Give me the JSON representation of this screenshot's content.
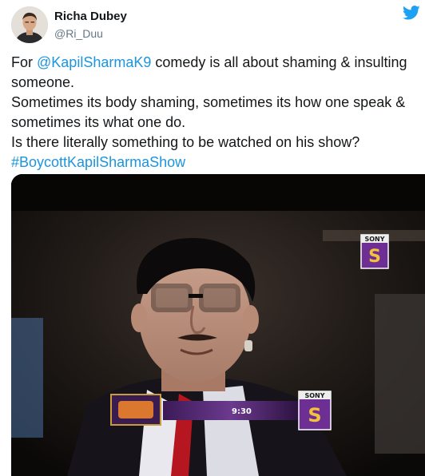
{
  "author": {
    "name": "Richa Dubey",
    "handle": "@Ri_Duu",
    "avatar_icon": "profile-photo",
    "platform_icon": "twitter-bird-icon"
  },
  "tweet": {
    "line1_prefix": "For ",
    "mention": "@KapilSharmaK9",
    "line1_suffix": " comedy is all about shaming & insulting",
    "line2": "someone.",
    "line3": "Sometimes its body shaming, sometimes its how one speak &",
    "line4": "sometimes its what one do.",
    "line5": "Is there literally something to be watched on his show?",
    "hashtag": "#BoycottKapilSharmaShow"
  },
  "media": {
    "channel_logo_top": "SONY",
    "channel_logo_bottom": "SONY",
    "promo_time": "9:30",
    "colors": {
      "link": "#1b95e0",
      "twitter_blue": "#1da1f2",
      "sony_badge": "#5b2a86"
    }
  }
}
